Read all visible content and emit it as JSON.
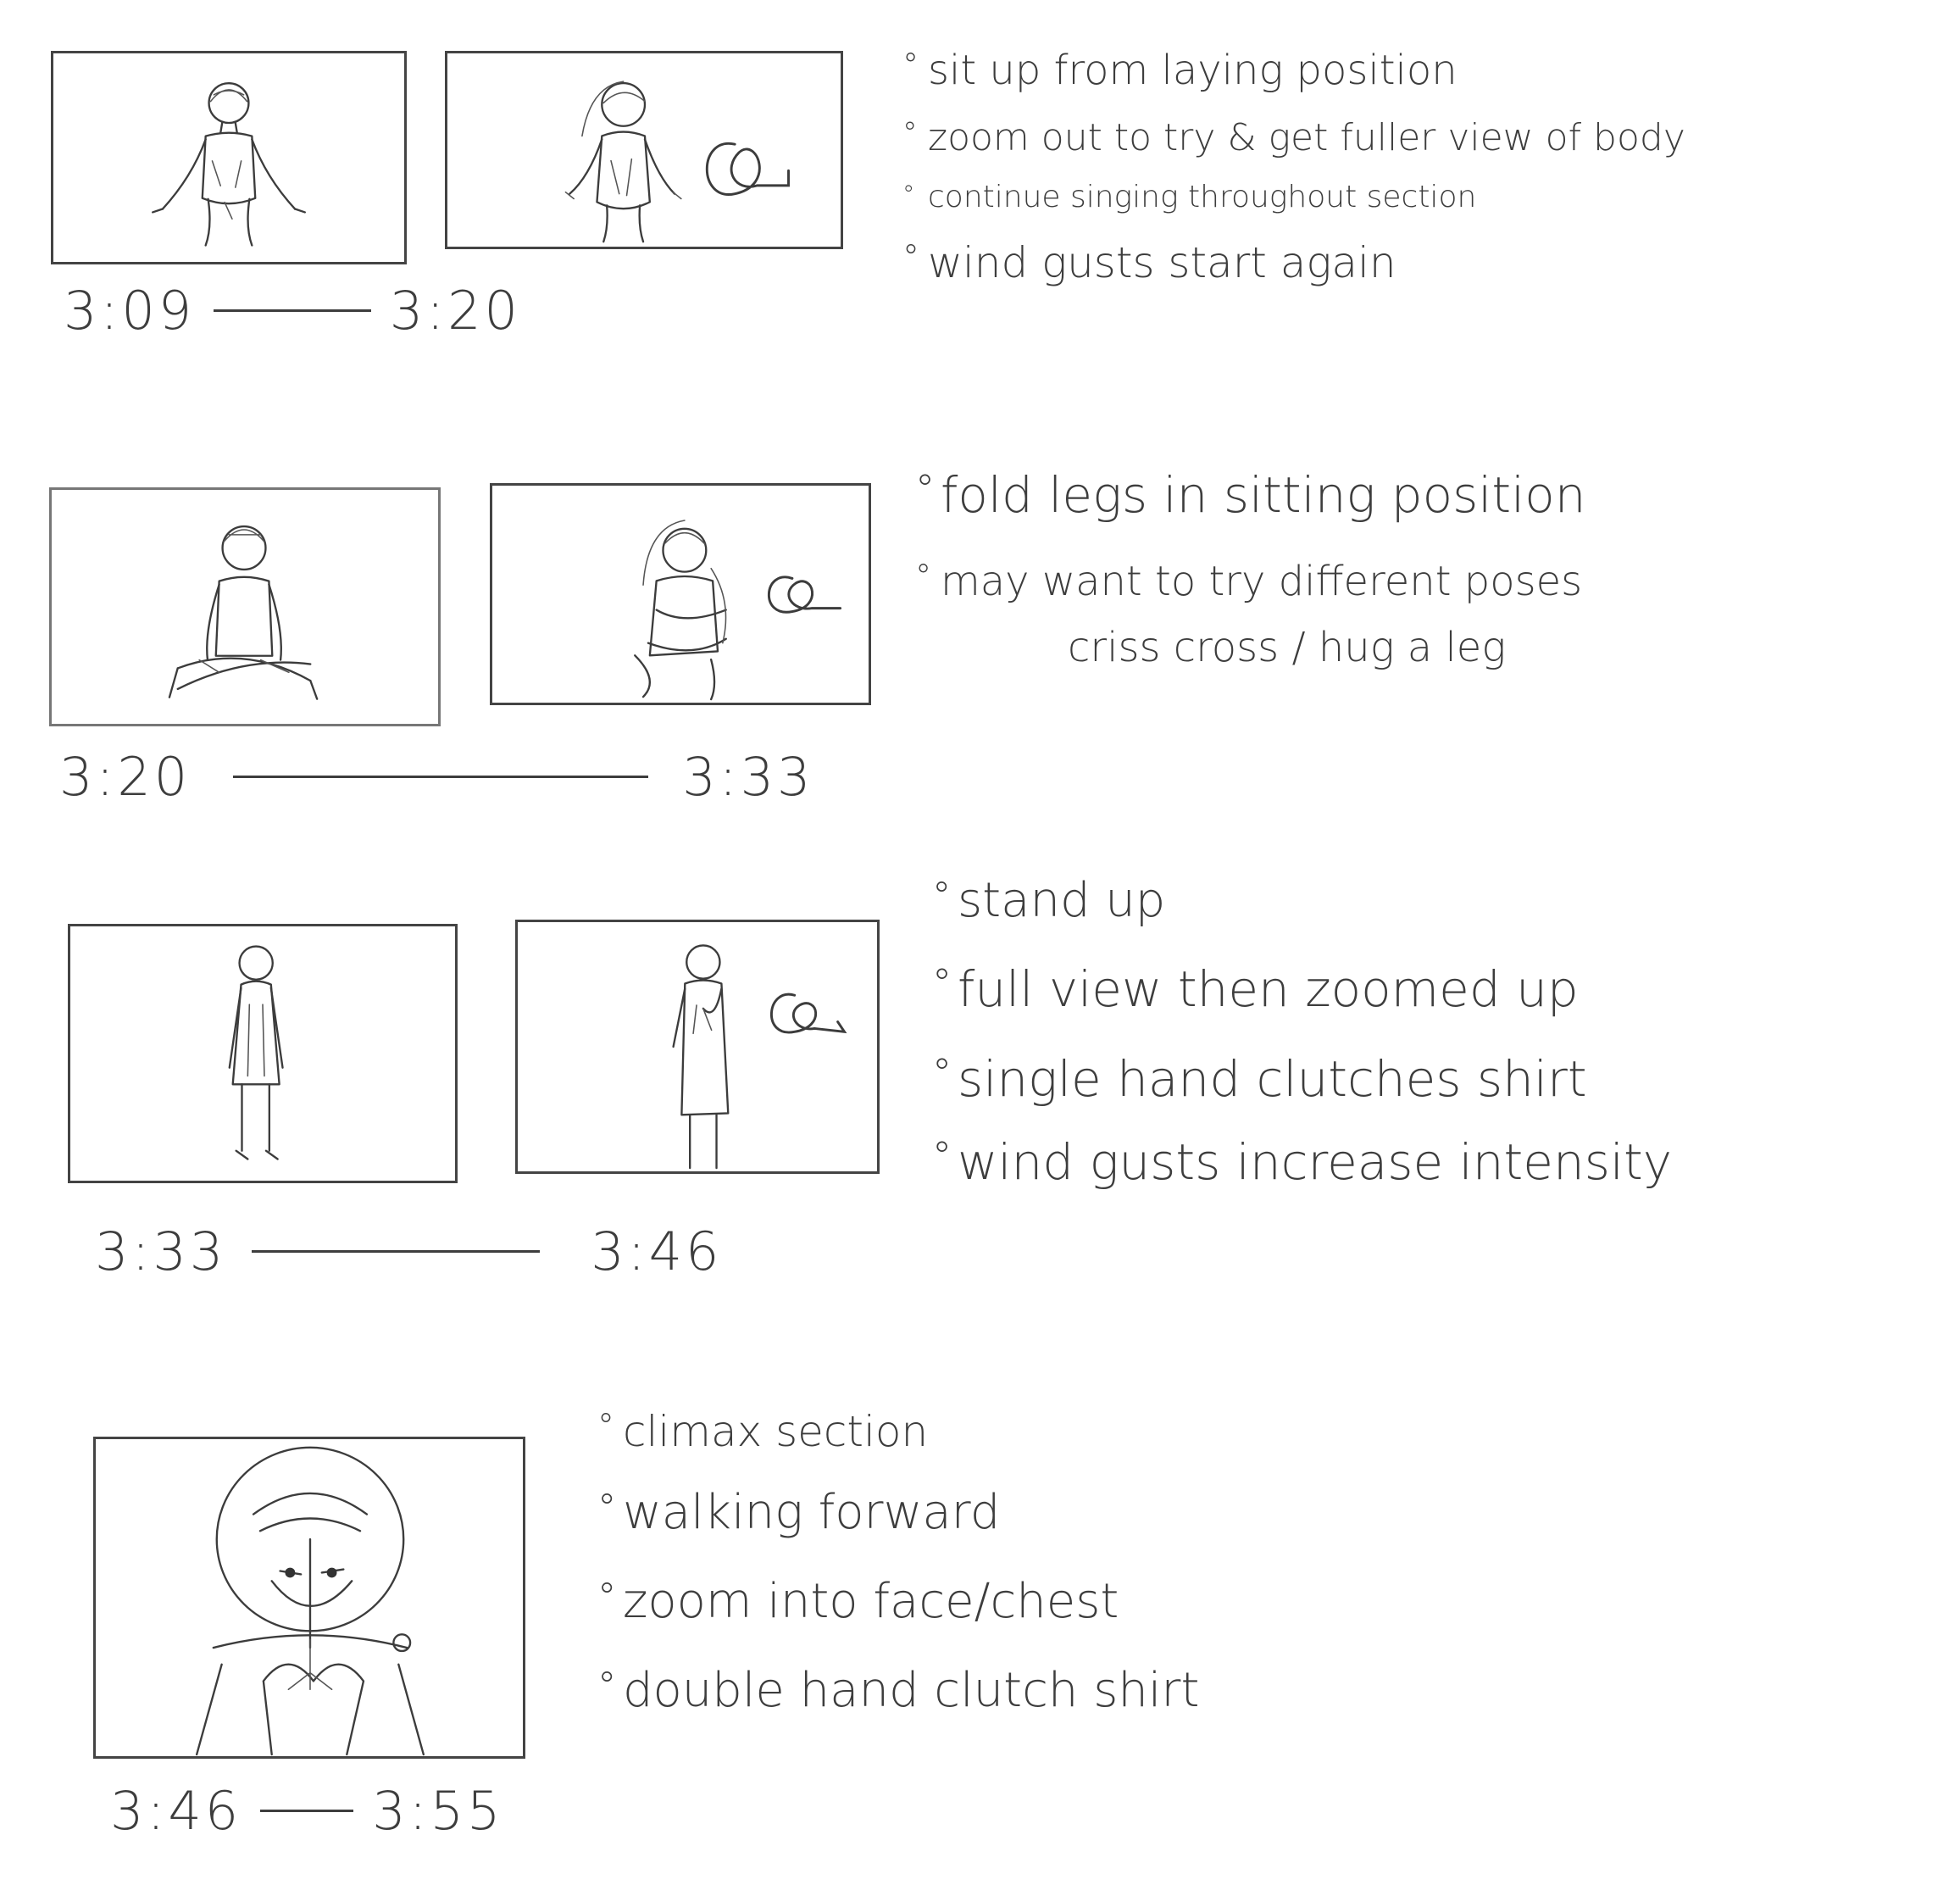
{
  "sections": [
    {
      "start": "3:09",
      "end": "3:20",
      "notes": [
        "sit up from laying position",
        "zoom out to try & get fuller view of body",
        "continue singing throughout section",
        "wind gusts start again"
      ]
    },
    {
      "start": "3:20",
      "end": "3:33",
      "notes": [
        "fold legs in sitting position",
        "may want to try different poses",
        "criss cross / hug a leg"
      ]
    },
    {
      "start": "3:33",
      "end": "3:46",
      "notes": [
        "stand up",
        "full view then zoomed up",
        "single hand clutches shirt",
        "wind gusts increase intensity"
      ]
    },
    {
      "start": "3:46",
      "end": "3:55",
      "notes": [
        "climax section",
        "walking forward",
        "zoom into face/chest",
        "double hand clutch shirt"
      ]
    }
  ],
  "icons": {
    "figure": "figure-sketch-icon",
    "wind": "wind-gust-icon",
    "portrait": "face-closeup-sketch-icon"
  }
}
